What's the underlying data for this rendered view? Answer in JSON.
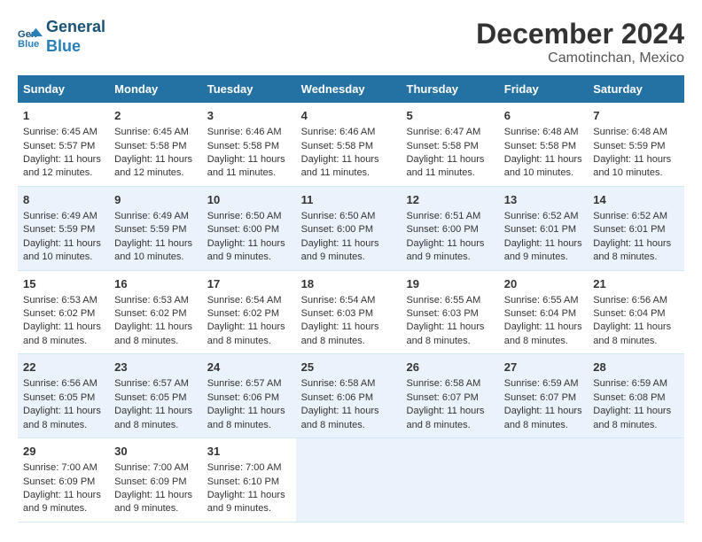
{
  "header": {
    "logo_line1": "General",
    "logo_line2": "Blue",
    "title": "December 2024",
    "subtitle": "Camotinchan, Mexico"
  },
  "columns": [
    "Sunday",
    "Monday",
    "Tuesday",
    "Wednesday",
    "Thursday",
    "Friday",
    "Saturday"
  ],
  "weeks": [
    [
      {
        "day": "1",
        "content": "Sunrise: 6:45 AM\nSunset: 5:57 PM\nDaylight: 11 hours and 12 minutes."
      },
      {
        "day": "2",
        "content": "Sunrise: 6:45 AM\nSunset: 5:58 PM\nDaylight: 11 hours and 12 minutes."
      },
      {
        "day": "3",
        "content": "Sunrise: 6:46 AM\nSunset: 5:58 PM\nDaylight: 11 hours and 11 minutes."
      },
      {
        "day": "4",
        "content": "Sunrise: 6:46 AM\nSunset: 5:58 PM\nDaylight: 11 hours and 11 minutes."
      },
      {
        "day": "5",
        "content": "Sunrise: 6:47 AM\nSunset: 5:58 PM\nDaylight: 11 hours and 11 minutes."
      },
      {
        "day": "6",
        "content": "Sunrise: 6:48 AM\nSunset: 5:58 PM\nDaylight: 11 hours and 10 minutes."
      },
      {
        "day": "7",
        "content": "Sunrise: 6:48 AM\nSunset: 5:59 PM\nDaylight: 11 hours and 10 minutes."
      }
    ],
    [
      {
        "day": "8",
        "content": "Sunrise: 6:49 AM\nSunset: 5:59 PM\nDaylight: 11 hours and 10 minutes."
      },
      {
        "day": "9",
        "content": "Sunrise: 6:49 AM\nSunset: 5:59 PM\nDaylight: 11 hours and 10 minutes."
      },
      {
        "day": "10",
        "content": "Sunrise: 6:50 AM\nSunset: 6:00 PM\nDaylight: 11 hours and 9 minutes."
      },
      {
        "day": "11",
        "content": "Sunrise: 6:50 AM\nSunset: 6:00 PM\nDaylight: 11 hours and 9 minutes."
      },
      {
        "day": "12",
        "content": "Sunrise: 6:51 AM\nSunset: 6:00 PM\nDaylight: 11 hours and 9 minutes."
      },
      {
        "day": "13",
        "content": "Sunrise: 6:52 AM\nSunset: 6:01 PM\nDaylight: 11 hours and 9 minutes."
      },
      {
        "day": "14",
        "content": "Sunrise: 6:52 AM\nSunset: 6:01 PM\nDaylight: 11 hours and 8 minutes."
      }
    ],
    [
      {
        "day": "15",
        "content": "Sunrise: 6:53 AM\nSunset: 6:02 PM\nDaylight: 11 hours and 8 minutes."
      },
      {
        "day": "16",
        "content": "Sunrise: 6:53 AM\nSunset: 6:02 PM\nDaylight: 11 hours and 8 minutes."
      },
      {
        "day": "17",
        "content": "Sunrise: 6:54 AM\nSunset: 6:02 PM\nDaylight: 11 hours and 8 minutes."
      },
      {
        "day": "18",
        "content": "Sunrise: 6:54 AM\nSunset: 6:03 PM\nDaylight: 11 hours and 8 minutes."
      },
      {
        "day": "19",
        "content": "Sunrise: 6:55 AM\nSunset: 6:03 PM\nDaylight: 11 hours and 8 minutes."
      },
      {
        "day": "20",
        "content": "Sunrise: 6:55 AM\nSunset: 6:04 PM\nDaylight: 11 hours and 8 minutes."
      },
      {
        "day": "21",
        "content": "Sunrise: 6:56 AM\nSunset: 6:04 PM\nDaylight: 11 hours and 8 minutes."
      }
    ],
    [
      {
        "day": "22",
        "content": "Sunrise: 6:56 AM\nSunset: 6:05 PM\nDaylight: 11 hours and 8 minutes."
      },
      {
        "day": "23",
        "content": "Sunrise: 6:57 AM\nSunset: 6:05 PM\nDaylight: 11 hours and 8 minutes."
      },
      {
        "day": "24",
        "content": "Sunrise: 6:57 AM\nSunset: 6:06 PM\nDaylight: 11 hours and 8 minutes."
      },
      {
        "day": "25",
        "content": "Sunrise: 6:58 AM\nSunset: 6:06 PM\nDaylight: 11 hours and 8 minutes."
      },
      {
        "day": "26",
        "content": "Sunrise: 6:58 AM\nSunset: 6:07 PM\nDaylight: 11 hours and 8 minutes."
      },
      {
        "day": "27",
        "content": "Sunrise: 6:59 AM\nSunset: 6:07 PM\nDaylight: 11 hours and 8 minutes."
      },
      {
        "day": "28",
        "content": "Sunrise: 6:59 AM\nSunset: 6:08 PM\nDaylight: 11 hours and 8 minutes."
      }
    ],
    [
      {
        "day": "29",
        "content": "Sunrise: 7:00 AM\nSunset: 6:09 PM\nDaylight: 11 hours and 9 minutes."
      },
      {
        "day": "30",
        "content": "Sunrise: 7:00 AM\nSunset: 6:09 PM\nDaylight: 11 hours and 9 minutes."
      },
      {
        "day": "31",
        "content": "Sunrise: 7:00 AM\nSunset: 6:10 PM\nDaylight: 11 hours and 9 minutes."
      },
      null,
      null,
      null,
      null
    ]
  ]
}
